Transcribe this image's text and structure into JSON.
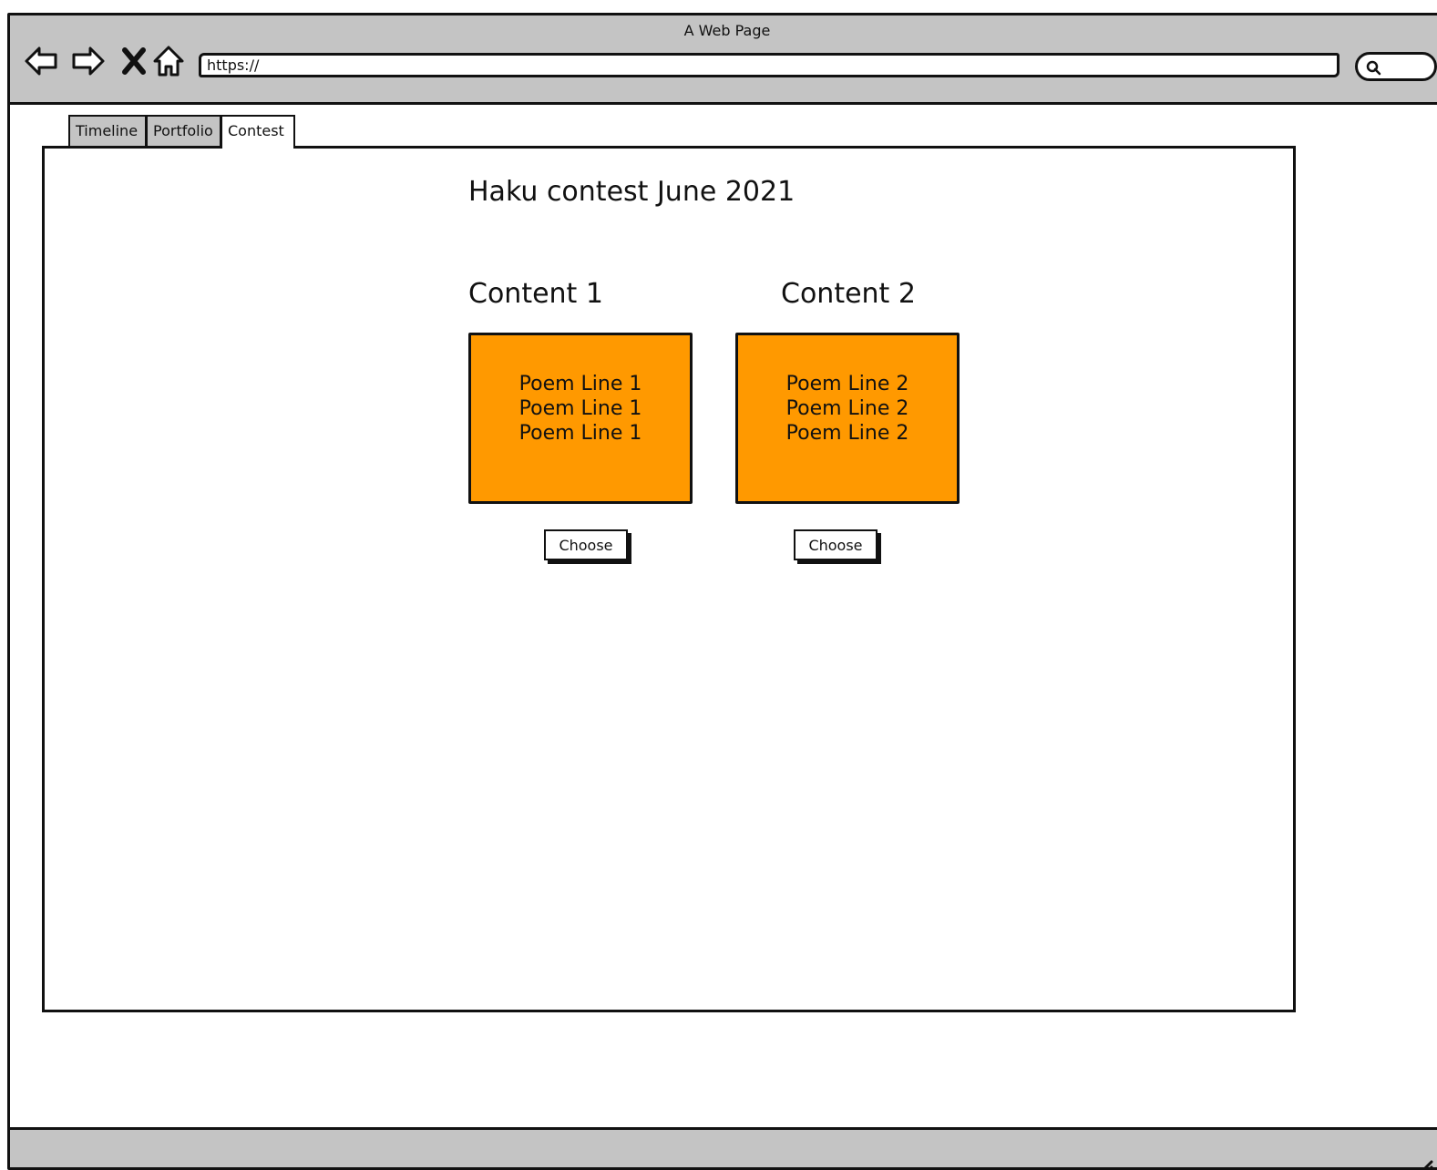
{
  "window": {
    "title": "A Web Page"
  },
  "toolbar": {
    "address": "https://",
    "icons": [
      "back-arrow-icon",
      "forward-arrow-icon",
      "close-x-icon",
      "home-icon",
      "search-icon"
    ]
  },
  "tabs": [
    {
      "label": "Timeline",
      "active": false
    },
    {
      "label": "Portfolio",
      "active": false
    },
    {
      "label": "Contest",
      "active": true
    }
  ],
  "contest": {
    "heading": "Haku contest June 2021",
    "entries": [
      {
        "title": "Content 1",
        "lines": [
          "Poem Line 1",
          "Poem Line 1",
          "Poem Line 1"
        ],
        "button": "Choose"
      },
      {
        "title": "Content 2",
        "lines": [
          "Poem Line 2",
          "Poem Line 2",
          "Poem Line 2"
        ],
        "button": "Choose"
      }
    ]
  },
  "colors": {
    "chrome": "#c4c4c4",
    "poem_box": "#ff9900",
    "outline": "#111111"
  }
}
